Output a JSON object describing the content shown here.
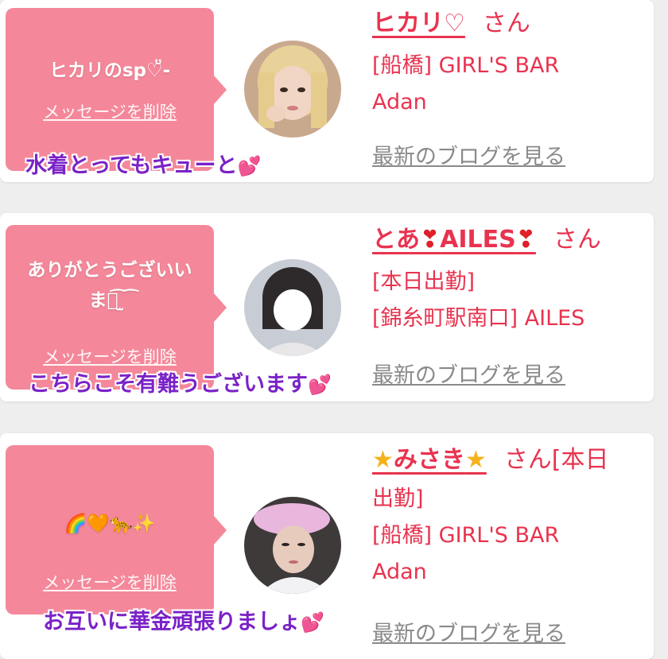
{
  "cards": [
    {
      "bubble_message": "ヒカリのsp♡̆̈-",
      "delete_label": "メッセージを削除",
      "name": "ヒカリ♡",
      "san": "さん",
      "details": [
        "[船橋] GIRL'S BAR",
        "Adan"
      ],
      "blog_label": "最新のブログを見る",
      "reply_overlay": "水着とってもキューと",
      "reply_emoji": "💕"
    },
    {
      "bubble_message_1": "ありがとうございい",
      "bubble_message_2": "ます͡ ̫ ͡",
      "delete_label": "メッセージを削除",
      "name_prefix": "とあ",
      "name_mid": "AILES",
      "heart": "❣",
      "san": "さん",
      "details": [
        "[本日出勤]",
        "[錦糸町駅南口] AILES"
      ],
      "blog_label": "最新のブログを見る",
      "reply_overlay": "こちらこそ有難うございます",
      "reply_emoji": "💕"
    },
    {
      "bubble_message": "🌈🧡🐆✨",
      "delete_label": "メッセージを削除",
      "name": "みさき",
      "star": "★",
      "san": "さん[本日",
      "details": [
        "出勤]",
        "[船橋] GIRL'S BAR",
        "Adan"
      ],
      "blog_label": "最新のブログを見る",
      "reply_overlay": "お互いに華金頑張りましょ",
      "reply_emoji": "💕"
    }
  ]
}
